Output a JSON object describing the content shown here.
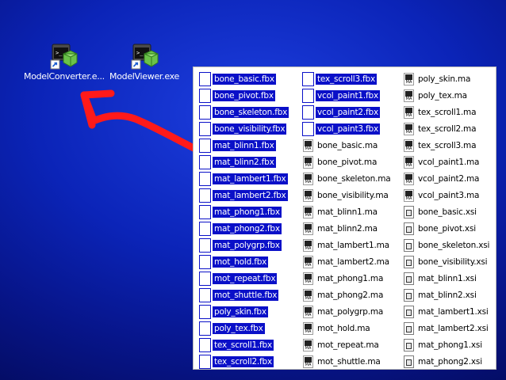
{
  "desktop": {
    "icons": [
      {
        "label": "ModelConverter.e..."
      },
      {
        "label": "ModelViewer.exe"
      }
    ]
  },
  "explorer": {
    "columns": [
      [
        {
          "name": "bone_basic.fbx",
          "type": "fbx",
          "selected": true
        },
        {
          "name": "bone_pivot.fbx",
          "type": "fbx",
          "selected": true
        },
        {
          "name": "bone_skeleton.fbx",
          "type": "fbx",
          "selected": true
        },
        {
          "name": "bone_visibility.fbx",
          "type": "fbx",
          "selected": true
        },
        {
          "name": "mat_blinn1.fbx",
          "type": "fbx",
          "selected": true
        },
        {
          "name": "mat_blinn2.fbx",
          "type": "fbx",
          "selected": true
        },
        {
          "name": "mat_lambert1.fbx",
          "type": "fbx",
          "selected": true
        },
        {
          "name": "mat_lambert2.fbx",
          "type": "fbx",
          "selected": true
        },
        {
          "name": "mat_phong1.fbx",
          "type": "fbx",
          "selected": true
        },
        {
          "name": "mat_phong2.fbx",
          "type": "fbx",
          "selected": true
        },
        {
          "name": "mat_polygrp.fbx",
          "type": "fbx",
          "selected": true
        },
        {
          "name": "mot_hold.fbx",
          "type": "fbx",
          "selected": true
        },
        {
          "name": "mot_repeat.fbx",
          "type": "fbx",
          "selected": true
        },
        {
          "name": "mot_shuttle.fbx",
          "type": "fbx",
          "selected": true
        },
        {
          "name": "poly_skin.fbx",
          "type": "fbx",
          "selected": true
        },
        {
          "name": "poly_tex.fbx",
          "type": "fbx",
          "selected": true
        },
        {
          "name": "tex_scroll1.fbx",
          "type": "fbx",
          "selected": true
        },
        {
          "name": "tex_scroll2.fbx",
          "type": "fbx",
          "selected": true
        }
      ],
      [
        {
          "name": "tex_scroll3.fbx",
          "type": "fbx",
          "selected": true
        },
        {
          "name": "vcol_paint1.fbx",
          "type": "fbx",
          "selected": true
        },
        {
          "name": "vcol_paint2.fbx",
          "type": "fbx",
          "selected": true
        },
        {
          "name": "vcol_paint3.fbx",
          "type": "fbx",
          "selected": true
        },
        {
          "name": "bone_basic.ma",
          "type": "ma",
          "selected": false
        },
        {
          "name": "bone_pivot.ma",
          "type": "ma",
          "selected": false
        },
        {
          "name": "bone_skeleton.ma",
          "type": "ma",
          "selected": false
        },
        {
          "name": "bone_visibility.ma",
          "type": "ma",
          "selected": false
        },
        {
          "name": "mat_blinn1.ma",
          "type": "ma",
          "selected": false
        },
        {
          "name": "mat_blinn2.ma",
          "type": "ma",
          "selected": false
        },
        {
          "name": "mat_lambert1.ma",
          "type": "ma",
          "selected": false
        },
        {
          "name": "mat_lambert2.ma",
          "type": "ma",
          "selected": false
        },
        {
          "name": "mat_phong1.ma",
          "type": "ma",
          "selected": false
        },
        {
          "name": "mat_phong2.ma",
          "type": "ma",
          "selected": false
        },
        {
          "name": "mat_polygrp.ma",
          "type": "ma",
          "selected": false
        },
        {
          "name": "mot_hold.ma",
          "type": "ma",
          "selected": false
        },
        {
          "name": "mot_repeat.ma",
          "type": "ma",
          "selected": false
        },
        {
          "name": "mot_shuttle.ma",
          "type": "ma",
          "selected": false
        }
      ],
      [
        {
          "name": "poly_skin.ma",
          "type": "ma",
          "selected": false
        },
        {
          "name": "poly_tex.ma",
          "type": "ma",
          "selected": false
        },
        {
          "name": "tex_scroll1.ma",
          "type": "ma",
          "selected": false
        },
        {
          "name": "tex_scroll2.ma",
          "type": "ma",
          "selected": false
        },
        {
          "name": "tex_scroll3.ma",
          "type": "ma",
          "selected": false
        },
        {
          "name": "vcol_paint1.ma",
          "type": "ma",
          "selected": false
        },
        {
          "name": "vcol_paint2.ma",
          "type": "ma",
          "selected": false
        },
        {
          "name": "vcol_paint3.ma",
          "type": "ma",
          "selected": false
        },
        {
          "name": "bone_basic.xsi",
          "type": "xsi",
          "selected": false
        },
        {
          "name": "bone_pivot.xsi",
          "type": "xsi",
          "selected": false
        },
        {
          "name": "bone_skeleton.xsi",
          "type": "xsi",
          "selected": false
        },
        {
          "name": "bone_visibility.xsi",
          "type": "xsi",
          "selected": false
        },
        {
          "name": "mat_blinn1.xsi",
          "type": "xsi",
          "selected": false
        },
        {
          "name": "mat_blinn2.xsi",
          "type": "xsi",
          "selected": false
        },
        {
          "name": "mat_lambert1.xsi",
          "type": "xsi",
          "selected": false
        },
        {
          "name": "mat_lambert2.xsi",
          "type": "xsi",
          "selected": false
        },
        {
          "name": "mat_phong1.xsi",
          "type": "xsi",
          "selected": false
        },
        {
          "name": "mat_phong2.xsi",
          "type": "xsi",
          "selected": false
        }
      ]
    ]
  },
  "colors": {
    "selection": "#0a10c8",
    "arrow": "#ff1a1a"
  }
}
